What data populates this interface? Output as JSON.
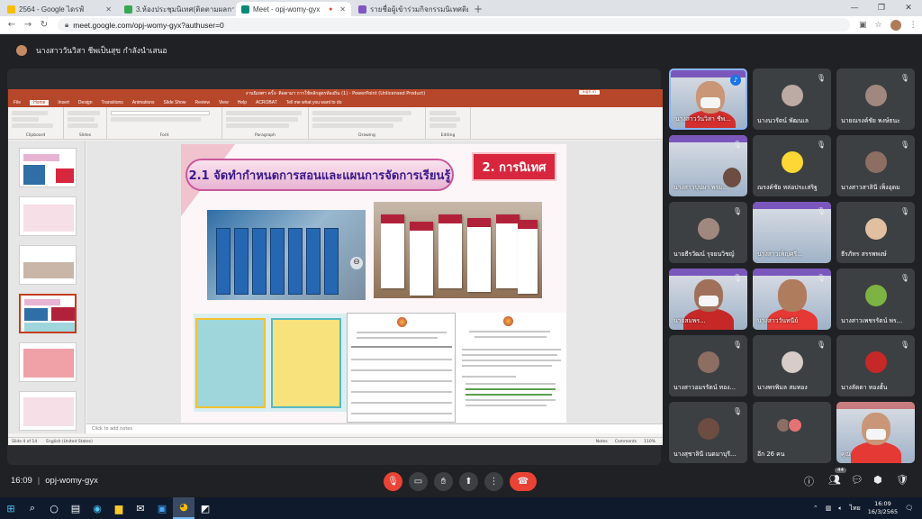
{
  "browser": {
    "tabs": [
      {
        "title": "2564 - Google ไดรฟ์",
        "active": false,
        "color": "#fbbc04"
      },
      {
        "title": "3.ห้องประชุมนิเทศ(ติดตามผลการนำนวัตกรรม",
        "active": false,
        "color": "#34a853"
      },
      {
        "title": "Meet - opj-womy-gyx",
        "active": true,
        "color": "#00897b"
      },
      {
        "title": "รายชื่อผู้เข้าร่วมกิจกรรมนิเทศติดตามผลการ",
        "active": false,
        "color": "#7e57c2"
      }
    ],
    "url": "meet.google.com/opj-womy-gyx?authuser=0",
    "new_tab": "+",
    "win_min": "—",
    "win_max": "❐",
    "win_close": "✕"
  },
  "presenter": {
    "text": "นางสาววันวิสา ชีพเป็นสุข กำลังนำเสนอ"
  },
  "powerpoint": {
    "title": "งานนิเทศฯ ครั้ง- ติดตามฯ การใช้หลักสูตรท้องถิ่น (1) -  PowerPoint (Unlicensed Product)",
    "signin": "Sign in",
    "menu": [
      "File",
      "Home",
      "Insert",
      "Design",
      "Transitions",
      "Animations",
      "Slide Show",
      "Review",
      "View",
      "Help",
      "ACROBAT",
      "Tell me what you want to do"
    ],
    "active_menu": "Home",
    "ribbon_groups": [
      "Clipboard",
      "Slides",
      "Font",
      "Paragraph",
      "Drawing",
      "Editing"
    ],
    "slide_numbers": [
      "1",
      "2",
      "3",
      "4",
      "5",
      "6"
    ],
    "notes_placeholder": "Click to add notes",
    "status_left": "Slide 4 of 14",
    "status_lang": "English (United States)",
    "status_notes": "Notes",
    "status_comments": "Comments",
    "zoom": "110%"
  },
  "slide": {
    "heading": "2.1 จัดทำกำหนดการสอนและแผนการจัดการเรียนรู้",
    "badge": "2. การนิเทศ"
  },
  "participants": [
    {
      "name": "นางสาววันวิสา ชีพ...",
      "type": "video",
      "speaking": true
    },
    {
      "name": "นางนวรัตน์ พัฒนเล",
      "type": "avatar"
    },
    {
      "name": "นายณรงค์ชัย พงษ์ธนะ",
      "type": "avatar"
    },
    {
      "name": "นางสาวบุปผา พรม...",
      "type": "video"
    },
    {
      "name": "ณรงค์ชัย หล่อประเสริฐ",
      "type": "avatar"
    },
    {
      "name": "นางสาวสาลินี เพ็งอุดม",
      "type": "avatar"
    },
    {
      "name": "นายธีรวัฒน์ รุจยนวิชญ์",
      "type": "avatar"
    },
    {
      "name": "นางสาวเพ็ญศรี...",
      "type": "video"
    },
    {
      "name": "ธีรภัทร สรรพพงษ์",
      "type": "avatar"
    },
    {
      "name": "นายสมพร...",
      "type": "video"
    },
    {
      "name": "นางสาววันทนีย์",
      "type": "video"
    },
    {
      "name": "นางสาวเพชรรัตน์ พร...",
      "type": "avatar"
    },
    {
      "name": "นางสาวอมรรัตน์ ทอง...",
      "type": "avatar"
    },
    {
      "name": "นางพรพิมล สมทอง",
      "type": "avatar"
    },
    {
      "name": "นางลัดดา ทองฮั้น",
      "type": "avatar"
    },
    {
      "name": "นางสุชาลินี เนตมาบุรี...",
      "type": "avatar"
    },
    {
      "name": "อีก 26 คน",
      "type": "more"
    },
    {
      "name": "คุณ",
      "type": "video"
    }
  ],
  "meeting": {
    "time": "16:09",
    "code": "opj-womy-gyx",
    "participant_count": "44"
  },
  "taskbar": {
    "time": "16:09",
    "date": "16/3/2565",
    "lang": "ไทย"
  }
}
